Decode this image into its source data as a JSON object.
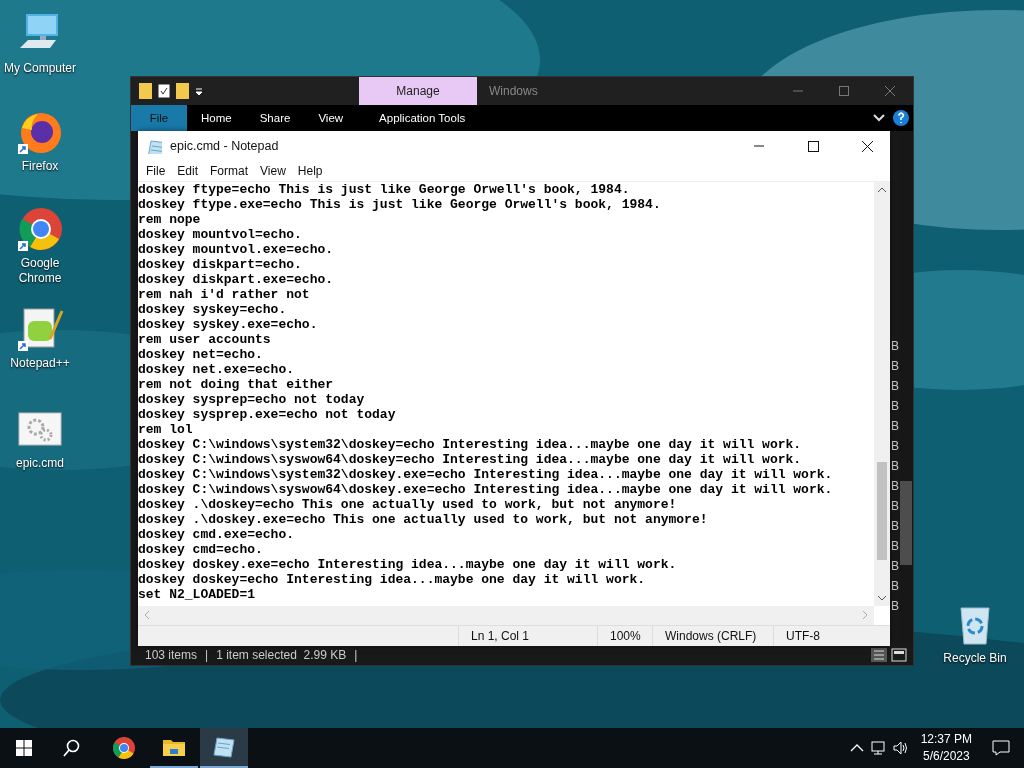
{
  "desktop_icons": [
    {
      "kind": "computer",
      "label": "My Computer"
    },
    {
      "kind": "firefox",
      "label": "Firefox"
    },
    {
      "kind": "chrome",
      "label": "Google Chrome"
    },
    {
      "kind": "notepadpp",
      "label": "Notepad++"
    },
    {
      "kind": "script",
      "label": "epic.cmd"
    },
    {
      "kind": "recycle",
      "label": "Recycle Bin"
    }
  ],
  "explorer": {
    "context_tab": "Manage",
    "title": "Windows",
    "ribbon_tabs": [
      {
        "label": "File",
        "selected": true
      },
      {
        "label": "Home",
        "selected": false
      },
      {
        "label": "Share",
        "selected": false
      },
      {
        "label": "View",
        "selected": false
      },
      {
        "label": "Application Tools",
        "selected": false
      }
    ],
    "size_column": [
      "B",
      "B",
      "B",
      "B",
      "B",
      "B",
      "B",
      "B",
      "B",
      "B",
      "B",
      "B",
      "B",
      "B"
    ],
    "status_bar": [
      {
        "kind": "text",
        "text": "103 items"
      },
      {
        "kind": "separator",
        "text": "|"
      },
      {
        "kind": "text",
        "text": "1 item selected  2.99 KB"
      },
      {
        "kind": "separator",
        "text": "|"
      }
    ]
  },
  "notepad": {
    "title": "epic.cmd - Notepad",
    "menu": [
      "File",
      "Edit",
      "Format",
      "View",
      "Help"
    ],
    "lines": [
      "doskey ftype=echo This is just like George Orwell's book, 1984.",
      "doskey ftype.exe=echo This is just like George Orwell's book, 1984.",
      "rem nope",
      "doskey mountvol=echo.",
      "doskey mountvol.exe=echo.",
      "doskey diskpart=echo.",
      "doskey diskpart.exe=echo.",
      "rem nah i'd rather not",
      "doskey syskey=echo.",
      "doskey syskey.exe=echo.",
      "rem user accounts",
      "doskey net=echo.",
      "doskey net.exe=echo.",
      "rem not doing that either",
      "doskey sysprep=echo not today",
      "doskey sysprep.exe=echo not today",
      "rem lol",
      "doskey C:\\windows\\system32\\doskey=echo Interesting idea...maybe one day it will work.",
      "doskey C:\\windows\\syswow64\\doskey=echo Interesting idea...maybe one day it will work.",
      "doskey C:\\windows\\system32\\doskey.exe=echo Interesting idea...maybe one day it will work.",
      "doskey C:\\windows\\syswow64\\doskey.exe=echo Interesting idea...maybe one day it will work.",
      "doskey .\\doskey=echo This one actually used to work, but not anymore!",
      "doskey .\\doskey.exe=echo This one actually used to work, but not anymore!",
      "doskey cmd.exe=echo.",
      "doskey cmd=echo.",
      "doskey doskey.exe=echo Interesting idea...maybe one day it will work.",
      "doskey doskey=echo Interesting idea...maybe one day it will work.",
      "set N2_LOADED=1"
    ],
    "status_bar": [
      "Ln 1, Col 1",
      "100%",
      "Windows (CRLF)",
      "UTF-8"
    ]
  },
  "taskbar": {
    "apps": [
      {
        "kind": "chrome",
        "running": false,
        "selected": false
      },
      {
        "kind": "folder",
        "running": true,
        "selected": false
      },
      {
        "kind": "notepad",
        "running": true,
        "selected": true
      }
    ],
    "time": "12:37 PM",
    "date": "5/6/2023"
  }
}
